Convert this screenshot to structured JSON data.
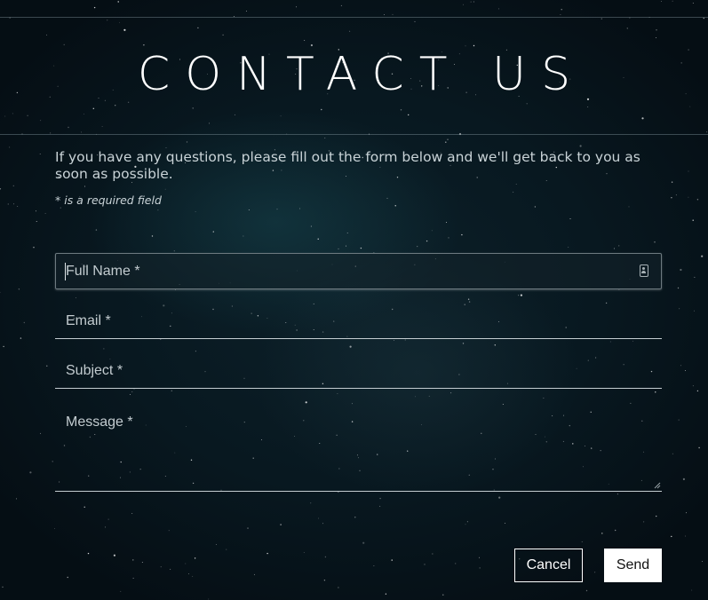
{
  "header": {
    "title": "CONTACT US"
  },
  "intro": {
    "text": "If you have any questions, please fill out the form below and we'll get back to you as soon as possible.",
    "required_note": "* is a required field"
  },
  "form": {
    "full_name": {
      "label": "Full Name *",
      "value": ""
    },
    "email": {
      "label": "Email *",
      "value": ""
    },
    "subject": {
      "label": "Subject *",
      "value": ""
    },
    "message": {
      "label": "Message *",
      "value": ""
    }
  },
  "actions": {
    "cancel_label": "Cancel",
    "send_label": "Send"
  },
  "icons": {
    "autofill": "contact-card-icon",
    "resize": "resize-grip-icon"
  },
  "colors": {
    "background": "#081820",
    "text": "#e6ecee",
    "send_bg": "#ffffff"
  }
}
